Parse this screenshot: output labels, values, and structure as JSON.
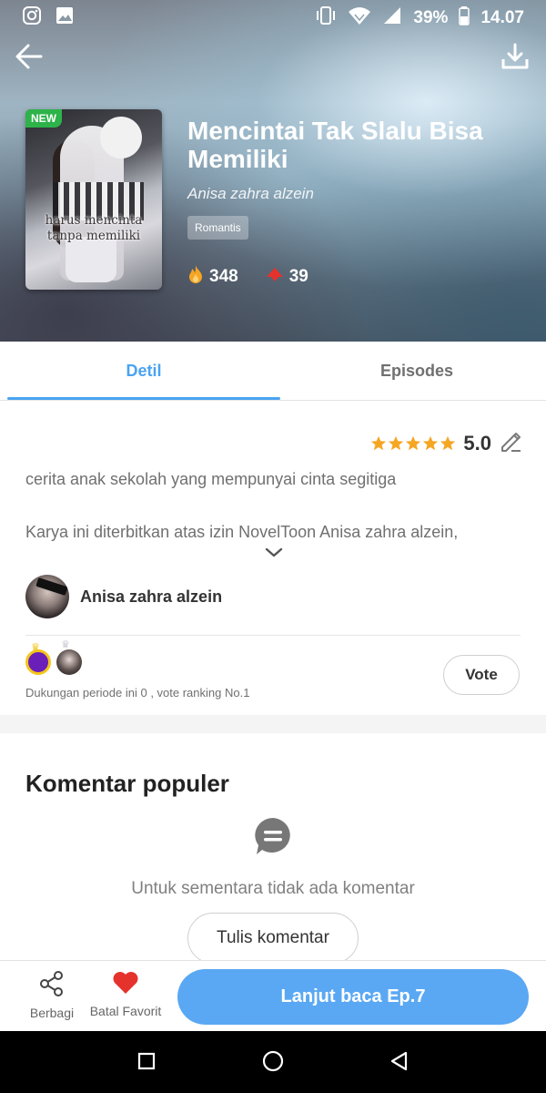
{
  "status_bar": {
    "battery": "39%",
    "time": "14.07",
    "icons": [
      "instagram-icon",
      "gallery-icon",
      "vibrate-icon",
      "wifi-icon",
      "signal-icon",
      "battery-icon"
    ]
  },
  "nav": {
    "icons": [
      "back-arrow-icon",
      "download-icon"
    ]
  },
  "book": {
    "badge": "NEW",
    "cover_caption_line1": "harus mencinta",
    "cover_caption_line2": "tanpa memiliki",
    "title": "Mencintai Tak Slalu Bisa Memiliki",
    "author": "Anisa zahra alzein",
    "genre": "Romantis",
    "popularity": "348",
    "likes": "39",
    "colors": {
      "fire": "#f5a623",
      "heart": "#e5322d"
    }
  },
  "tabs": [
    {
      "label": "Detil",
      "active": true
    },
    {
      "label": "Episodes",
      "active": false
    }
  ],
  "detail": {
    "rating_stars": 5,
    "rating_value": "5.0",
    "description": "cerita anak sekolah yang mempunyai cinta segitiga",
    "license_text": "Karya ini diterbitkan atas izin NovelToon Anisa zahra alzein,",
    "author_name": "Anisa zahra alzein",
    "support_text": "Dukungan periode ini 0 , vote ranking No.1",
    "vote_label": "Vote"
  },
  "comments": {
    "title": "Komentar populer",
    "empty_text": "Untuk sementara tidak ada komentar",
    "write_button": "Tulis komentar"
  },
  "bottom_bar": {
    "share_label": "Berbagi",
    "favorite_label": "Batal Favorit",
    "continue_label": "Lanjut baca Ep.7",
    "accent": "#5aa8f3"
  },
  "system_nav": {
    "icons": [
      "recent-apps-icon",
      "home-icon",
      "back-icon"
    ]
  }
}
